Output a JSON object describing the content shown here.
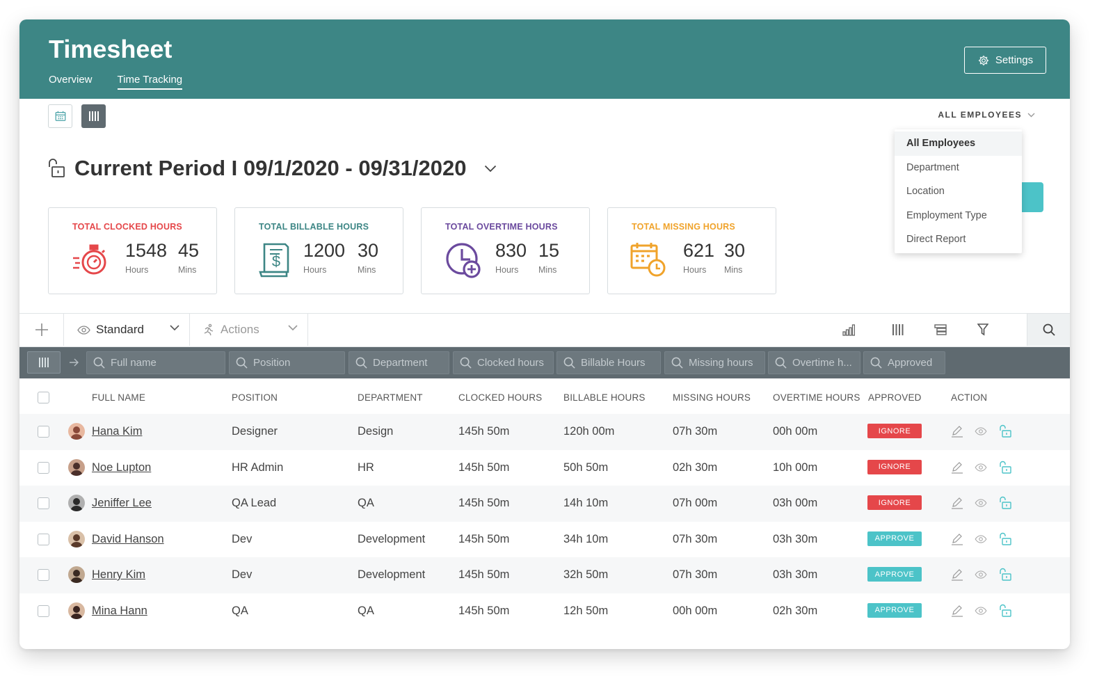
{
  "header": {
    "title": "Timesheet",
    "tabs": [
      {
        "label": "Overview"
      },
      {
        "label": "Time Tracking",
        "active": true
      }
    ],
    "settings_label": "Settings"
  },
  "filter": {
    "label": "ALL EMPLOYEES",
    "options": [
      "All Employees",
      "Department",
      "Location",
      "Employment Type",
      "Direct Report"
    ],
    "selected": "All Employees"
  },
  "period": {
    "title": "Current Period I 09/1/2020 - 09/31/2020"
  },
  "stats": [
    {
      "label": "TOTAL CLOCKED HOURS",
      "hours": "1548",
      "mins": "45",
      "hours_unit": "Hours",
      "mins_unit": "Mins",
      "color": "#e5474a",
      "icon": "stopwatch-icon"
    },
    {
      "label": "TOTAL BILLABLE HOURS",
      "hours": "1200",
      "mins": "30",
      "hours_unit": "Hours",
      "mins_unit": "Mins",
      "color": "#3d8685",
      "icon": "invoice-icon"
    },
    {
      "label": "TOTAL OVERTIME HOURS",
      "hours": "830",
      "mins": "15",
      "hours_unit": "Hours",
      "mins_unit": "Mins",
      "color": "#6b4a9e",
      "icon": "clock-plus-icon"
    },
    {
      "label": "TOTAL MISSING HOURS",
      "hours": "621",
      "mins": "30",
      "hours_unit": "Hours",
      "mins_unit": "Mins",
      "color": "#f0a32b",
      "icon": "calendar-clock-icon"
    }
  ],
  "toolbar": {
    "view_label": "Standard",
    "actions_label": "Actions"
  },
  "filters": [
    "Full name",
    "Position",
    "Department",
    "Clocked hours",
    "Billable Hours",
    "Missing hours",
    "Overtime h...",
    "Approved"
  ],
  "table": {
    "columns": [
      "FULL NAME",
      "POSITION",
      "DEPARTMENT",
      "CLOCKED HOURS",
      "BILLABLE HOURS",
      "MISSING HOURS",
      "OVERTIME HOURS",
      "APPROVED",
      "ACTION"
    ],
    "rows": [
      {
        "name": "Hana Kim",
        "position": "Designer",
        "department": "Design",
        "clocked": "145h 50m",
        "billable": "120h 00m",
        "missing": "07h 30m",
        "overtime": "00h 00m",
        "approved": "IGNORE"
      },
      {
        "name": "Noe Lupton",
        "position": "HR Admin",
        "department": "HR",
        "clocked": "145h 50m",
        "billable": "50h 50m",
        "missing": "02h 30m",
        "overtime": "10h 00m",
        "approved": "IGNORE"
      },
      {
        "name": "Jeniffer Lee",
        "position": "QA Lead",
        "department": "QA",
        "clocked": "145h 50m",
        "billable": "14h 10m",
        "missing": "07h 00m",
        "overtime": "03h 00m",
        "approved": "IGNORE"
      },
      {
        "name": "David Hanson",
        "position": "Dev",
        "department": "Development",
        "clocked": "145h 50m",
        "billable": "34h 10m",
        "missing": "07h 30m",
        "overtime": "03h 30m",
        "approved": "APPROVE"
      },
      {
        "name": "Henry Kim",
        "position": "Dev",
        "department": "Development",
        "clocked": "145h 50m",
        "billable": "32h 50m",
        "missing": "07h 30m",
        "overtime": "03h 30m",
        "approved": "APPROVE"
      },
      {
        "name": "Mina Hann",
        "position": "QA",
        "department": "QA",
        "clocked": "145h 50m",
        "billable": "12h 50m",
        "missing": "00h 00m",
        "overtime": "02h 30m",
        "approved": "APPROVE"
      }
    ]
  },
  "colors": {
    "header": "#3d8685",
    "ignore": "#e5474a",
    "approve": "#4cc3c8",
    "filter_bar": "#5f6a70"
  }
}
